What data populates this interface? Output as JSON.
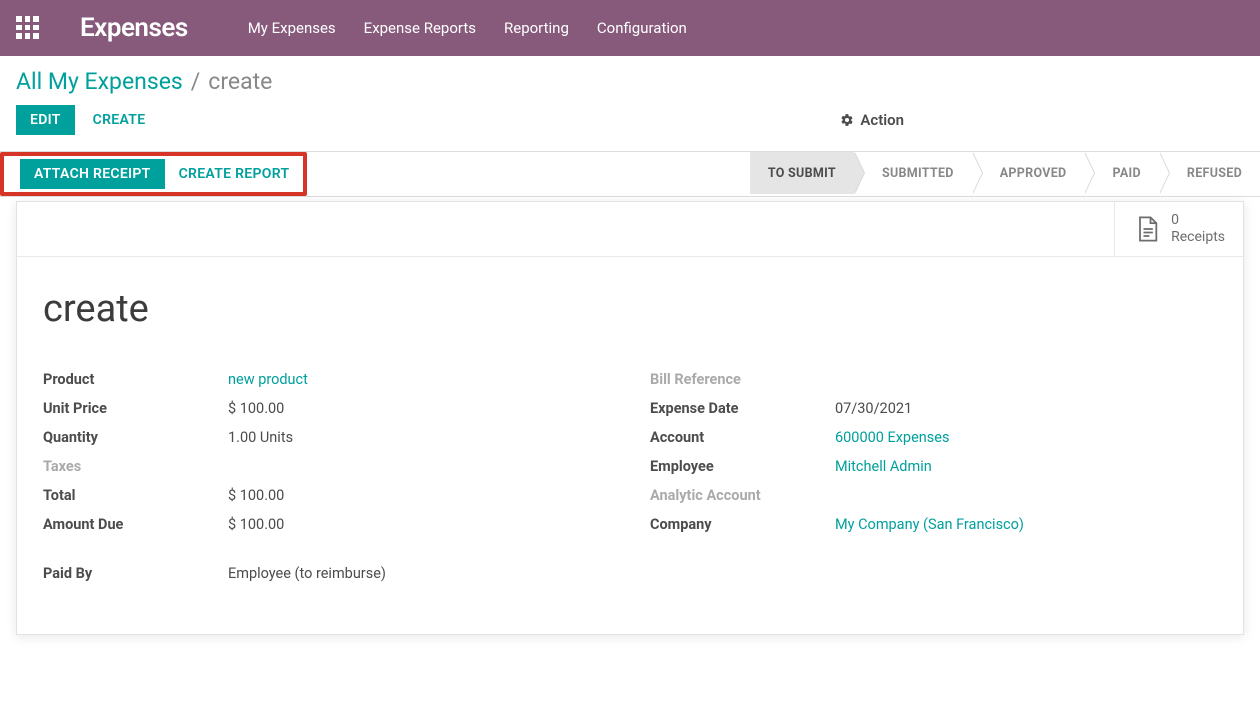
{
  "navbar": {
    "brand": "Expenses",
    "menu": [
      "My Expenses",
      "Expense Reports",
      "Reporting",
      "Configuration"
    ]
  },
  "breadcrumb": {
    "parent": "All My Expenses",
    "separator": "/",
    "current": "create"
  },
  "buttons": {
    "edit": "EDIT",
    "create": "CREATE",
    "action": "Action",
    "attach_receipt": "ATTACH RECEIPT",
    "create_report": "CREATE REPORT"
  },
  "stages": [
    "TO SUBMIT",
    "SUBMITTED",
    "APPROVED",
    "PAID",
    "REFUSED"
  ],
  "stage_active": "TO SUBMIT",
  "stat": {
    "count": "0",
    "label": "Receipts"
  },
  "record": {
    "title": "create",
    "left": {
      "product_label": "Product",
      "product_value": "new product",
      "unit_price_label": "Unit Price",
      "unit_price_value": "$ 100.00",
      "quantity_label": "Quantity",
      "quantity_value": "1.00",
      "quantity_uom": "Units",
      "taxes_label": "Taxes",
      "taxes_value": "",
      "total_label": "Total",
      "total_value": "$ 100.00",
      "amount_due_label": "Amount Due",
      "amount_due_value": "$ 100.00",
      "paid_by_label": "Paid By",
      "paid_by_value": "Employee (to reimburse)"
    },
    "right": {
      "bill_ref_label": "Bill Reference",
      "bill_ref_value": "",
      "expense_date_label": "Expense Date",
      "expense_date_value": "07/30/2021",
      "account_label": "Account",
      "account_value": "600000 Expenses",
      "employee_label": "Employee",
      "employee_value": "Mitchell Admin",
      "analytic_label": "Analytic Account",
      "analytic_value": "",
      "company_label": "Company",
      "company_value": "My Company (San Francisco)"
    }
  }
}
